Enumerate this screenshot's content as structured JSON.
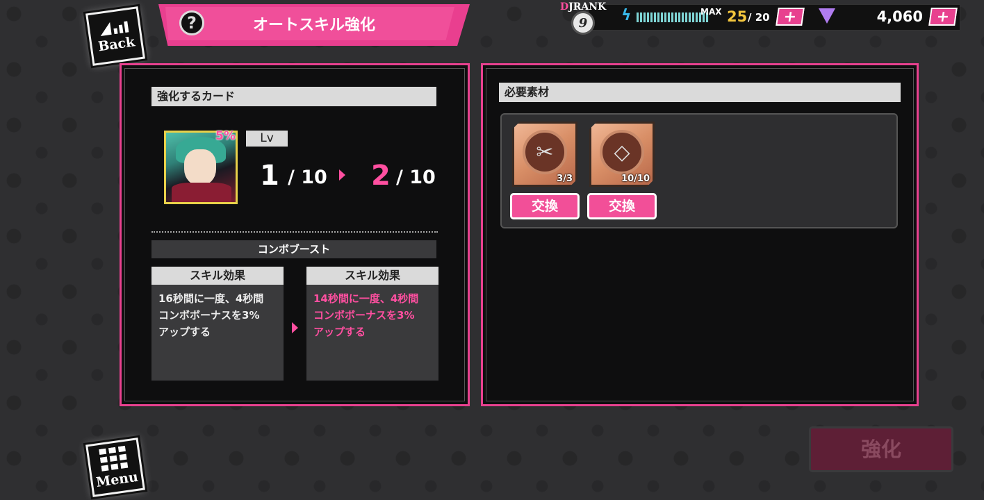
{
  "header": {
    "back_label": "Back",
    "title": "オートスキル強化",
    "help_symbol": "?"
  },
  "status": {
    "rank_label": "JRANK",
    "rank_prefix": "D",
    "rank_value": "9",
    "max_label": "MAX",
    "stamina_current": "25",
    "stamina_max": "/ 20",
    "gem_count": "4,060",
    "plus_symbol": "+"
  },
  "left_panel": {
    "section_title": "強化するカード",
    "card_percent": "5%",
    "lv_label": "Lv",
    "level_current": "1",
    "level_current_max": "/ 10",
    "level_next": "2",
    "level_next_max": "/ 10",
    "skill_name": "コンボブースト",
    "current_skill": {
      "header": "スキル効果",
      "text": "16秒間に一度、4秒間\nコンボボーナスを3%\nアップする"
    },
    "next_skill": {
      "header": "スキル効果",
      "text": "14秒間に一度、4秒間\nコンボボーナスを3%\nアップする"
    }
  },
  "right_panel": {
    "section_title": "必要素材",
    "materials": [
      {
        "count": "3/3",
        "icon": "scissors-icon",
        "button": "交換"
      },
      {
        "count": "10/10",
        "icon": "diamond-icon",
        "button": "交換"
      }
    ]
  },
  "footer": {
    "menu_label": "Menu",
    "enhance_label": "強化"
  },
  "colors": {
    "accent_pink": "#e8418f",
    "stamina_yellow": "#f3c63d",
    "disabled_button": "#5e1f36"
  }
}
